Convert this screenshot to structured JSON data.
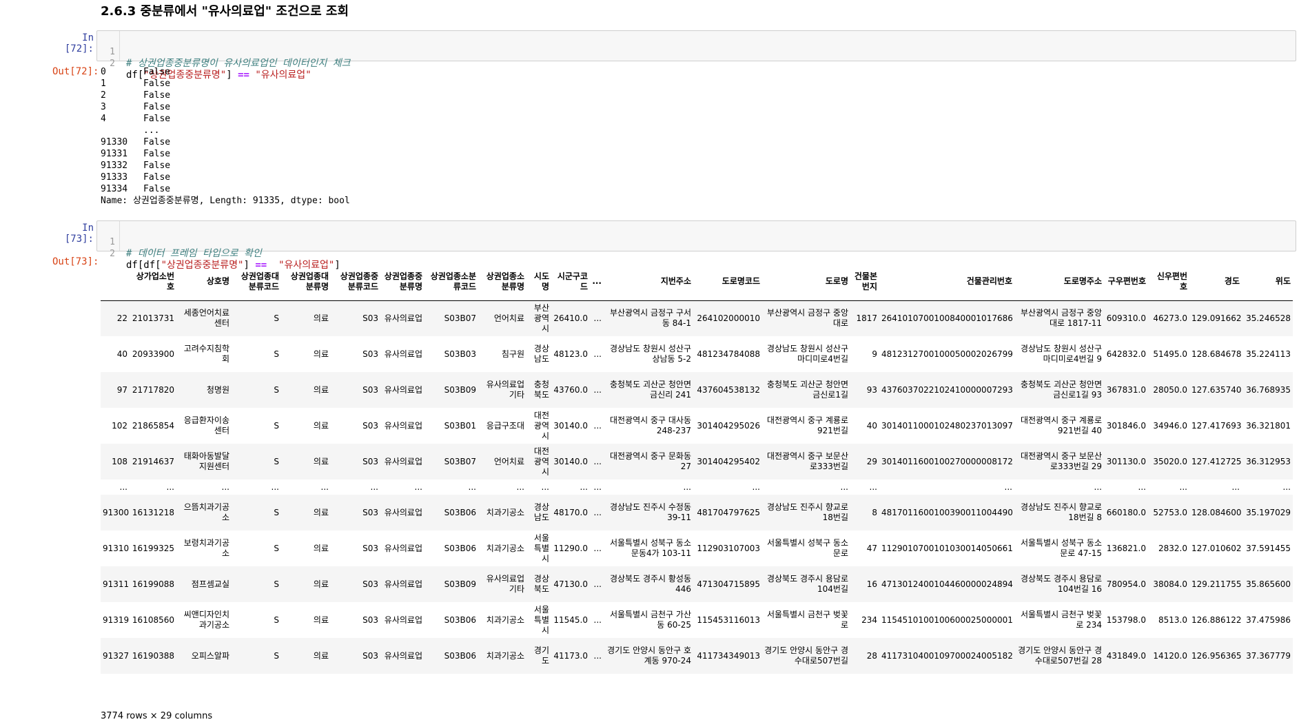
{
  "heading": "2.6.3 중분류에서 \"유사의료업\" 조건으로 조회",
  "cells": {
    "c72": {
      "in_prompt": "In [72]:",
      "out_prompt": "Out[72]:",
      "lines": [
        {
          "no": "1",
          "comment": "# 상권업종중분류명이 유사의료업인 데이터인지 체크"
        },
        {
          "no": "2",
          "a": "df[",
          "s1": "\"상권업종중분류명\"",
          "b": "] ",
          "op": "==",
          "c": " ",
          "s2": "\"유사의료업\""
        }
      ],
      "output": [
        {
          "idx": "0",
          "val": "False"
        },
        {
          "idx": "1",
          "val": "False"
        },
        {
          "idx": "2",
          "val": "False"
        },
        {
          "idx": "3",
          "val": "False"
        },
        {
          "idx": "4",
          "val": "False"
        },
        {
          "idx": "",
          "val": "..."
        },
        {
          "idx": "91330",
          "val": "False"
        },
        {
          "idx": "91331",
          "val": "False"
        },
        {
          "idx": "91332",
          "val": "False"
        },
        {
          "idx": "91333",
          "val": "False"
        },
        {
          "idx": "91334",
          "val": "False"
        }
      ],
      "name_line": "Name: 상권업종중분류명, Length: 91335, dtype: bool"
    },
    "c73": {
      "in_prompt": "In [73]:",
      "out_prompt": "Out[73]:",
      "lines": [
        {
          "no": "1",
          "comment": "# 데이터 프레임 타입으로 확인"
        },
        {
          "no": "2",
          "a": "df[df[",
          "s1": "\"상권업종중분류명\"",
          "b": "] ",
          "op": "==",
          "c": "  ",
          "s2": "\"유사의료업\"",
          "d": "]"
        }
      ]
    }
  },
  "dataframe": {
    "columns": [
      "",
      "상가업소번호",
      "상호명",
      "상권업종대분류코드",
      "상권업종대분류명",
      "상권업종중분류코드",
      "상권업종중분류명",
      "상권업종소분류코드",
      "상권업종소분류명",
      "시도명",
      "시군구코드",
      "...",
      "지번주소",
      "도로명코드",
      "도로명",
      "건물본번지",
      "건물관리번호",
      "도로명주소",
      "구우편번호",
      "신우편번호",
      "경도",
      "위도"
    ],
    "rows": [
      [
        "22",
        "21013731",
        "세종언어치료센터",
        "S",
        "의료",
        "S03",
        "유사의료업",
        "S03B07",
        "언어치료",
        "부산광역시",
        "26410.0",
        "...",
        "부산광역시 금정구 구서동 84-1",
        "264102000010",
        "부산광역시 금정구 중앙대로",
        "1817",
        "2641010700100840001017686",
        "부산광역시 금정구 중앙대로 1817-11",
        "609310.0",
        "46273.0",
        "129.091662",
        "35.246528"
      ],
      [
        "40",
        "20933900",
        "고려수지침학회",
        "S",
        "의료",
        "S03",
        "유사의료업",
        "S03B03",
        "침구원",
        "경상남도",
        "48123.0",
        "...",
        "경상남도 창원시 성산구 상남동 5-2",
        "481234784088",
        "경상남도 창원시 성산구 마디미로4번길",
        "9",
        "4812312700100050002026799",
        "경상남도 창원시 성산구 마디미로4번길 9",
        "642832.0",
        "51495.0",
        "128.684678",
        "35.224113"
      ],
      [
        "97",
        "21717820",
        "청명원",
        "S",
        "의료",
        "S03",
        "유사의료업",
        "S03B09",
        "유사의료업기타",
        "충청북도",
        "43760.0",
        "...",
        "충청북도 괴산군 청안면 금신리 241",
        "437604538132",
        "충청북도 괴산군 청안면 금신로1길",
        "93",
        "4376037022102410000007293",
        "충청북도 괴산군 청안면 금신로1길 93",
        "367831.0",
        "28050.0",
        "127.635740",
        "36.768935"
      ],
      [
        "102",
        "21865854",
        "응급환자이송센터",
        "S",
        "의료",
        "S03",
        "유사의료업",
        "S03B01",
        "응급구조대",
        "대전광역시",
        "30140.0",
        "...",
        "대전광역시 중구 대사동 248-237",
        "301404295026",
        "대전광역시 중구 계룡로921번길",
        "40",
        "3014011000102480237013097",
        "대전광역시 중구 계룡로921번길 40",
        "301846.0",
        "34946.0",
        "127.417693",
        "36.321801"
      ],
      [
        "108",
        "21914637",
        "태화아동발달지원센터",
        "S",
        "의료",
        "S03",
        "유사의료업",
        "S03B07",
        "언어치료",
        "대전광역시",
        "30140.0",
        "...",
        "대전광역시 중구 문화동 27",
        "301404295402",
        "대전광역시 중구 보문산로333번길",
        "29",
        "3014011600100270000008172",
        "대전광역시 중구 보문산로333번길 29",
        "301130.0",
        "35020.0",
        "127.412725",
        "36.312953"
      ],
      [
        "...",
        "...",
        "...",
        "...",
        "...",
        "...",
        "...",
        "...",
        "...",
        "...",
        "...",
        "...",
        "...",
        "...",
        "...",
        "...",
        "...",
        "...",
        "...",
        "...",
        "...",
        "..."
      ],
      [
        "91300",
        "16131218",
        "으뜸치과기공소",
        "S",
        "의료",
        "S03",
        "유사의료업",
        "S03B06",
        "치과기공소",
        "경상남도",
        "48170.0",
        "...",
        "경상남도 진주시 수정동 39-11",
        "481704797625",
        "경상남도 진주시 향교로18번길",
        "8",
        "4817011600100390011004490",
        "경상남도 진주시 향교로18번길 8",
        "660180.0",
        "52753.0",
        "128.084600",
        "35.197029"
      ],
      [
        "91310",
        "16199325",
        "보령치과기공소",
        "S",
        "의료",
        "S03",
        "유사의료업",
        "S03B06",
        "치과기공소",
        "서울특별시",
        "11290.0",
        "...",
        "서울특별시 성북구 동소문동4가 103-11",
        "112903107003",
        "서울특별시 성북구 동소문로",
        "47",
        "1129010700101030014050661",
        "서울특별시 성북구 동소문로 47-15",
        "136821.0",
        "2832.0",
        "127.010602",
        "37.591455"
      ],
      [
        "91311",
        "16199088",
        "점프셈교실",
        "S",
        "의료",
        "S03",
        "유사의료업",
        "S03B09",
        "유사의료업기타",
        "경상북도",
        "47130.0",
        "...",
        "경상북도 경주시 황성동 446",
        "471304715895",
        "경상북도 경주시 용담로104번길",
        "16",
        "4713012400104460000024894",
        "경상북도 경주시 용담로104번길 16",
        "780954.0",
        "38084.0",
        "129.211755",
        "35.865600"
      ],
      [
        "91319",
        "16108560",
        "씨앤디자인치과기공소",
        "S",
        "의료",
        "S03",
        "유사의료업",
        "S03B06",
        "치과기공소",
        "서울특별시",
        "11545.0",
        "...",
        "서울특별시 금천구 가산동 60-25",
        "115453116013",
        "서울특별시 금천구 벚꽃로",
        "234",
        "1154510100100600025000001",
        "서울특별시 금천구 벚꽃로 234",
        "153798.0",
        "8513.0",
        "126.886122",
        "37.475986"
      ],
      [
        "91327",
        "16190388",
        "오피스알파",
        "S",
        "의료",
        "S03",
        "유사의료업",
        "S03B06",
        "치과기공소",
        "경기도",
        "41173.0",
        "...",
        "경기도 안양시 동안구 호계동 970-24",
        "411734349013",
        "경기도 안양시 동안구 경수대로507번길",
        "28",
        "4117310400109700024005182",
        "경기도 안양시 동안구 경수대로507번길 28",
        "431849.0",
        "14120.0",
        "126.956365",
        "37.367779"
      ]
    ],
    "shape_text": "3774 rows × 29 columns"
  },
  "colors": {
    "in_prompt": "#303f9f",
    "out_prompt": "#d84315",
    "code_bg": "#f7f7f7",
    "comment": "#408080",
    "string": "#ba2121",
    "operator": "#aa22ff"
  }
}
